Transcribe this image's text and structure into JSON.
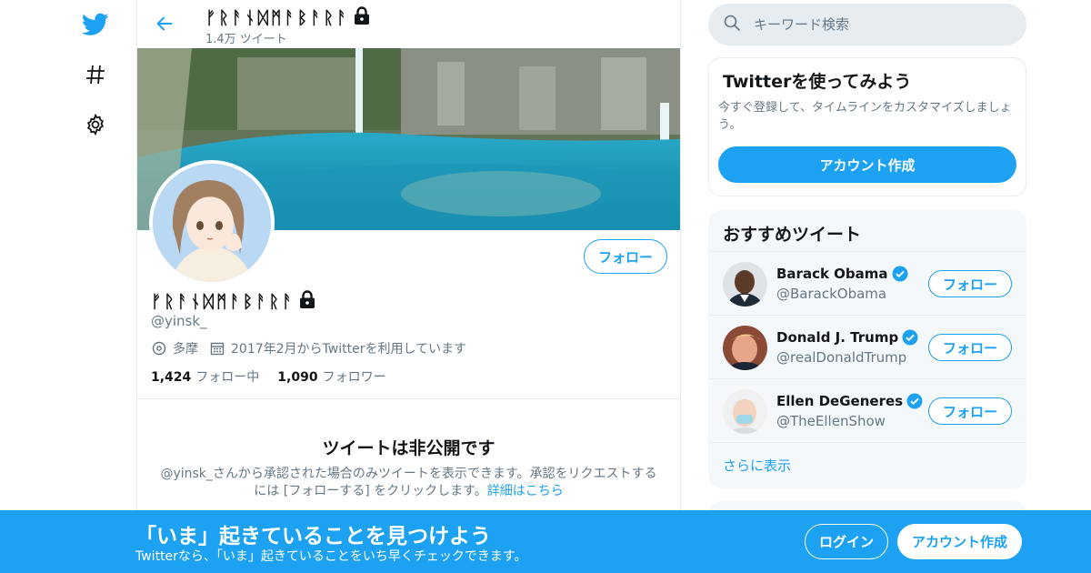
{
  "colors": {
    "accent": "#1da1f2",
    "text": "#14171a",
    "muted": "#657786",
    "border": "#e6ecf0"
  },
  "nav": {
    "items": [
      {
        "icon": "twitter-bird-icon"
      },
      {
        "icon": "hashtag-icon"
      },
      {
        "icon": "gear-icon"
      }
    ]
  },
  "profile": {
    "display_name": "ᚠᚱᚨᚾᛞᛗᚨᛒᚨᚱᚨ",
    "tweet_count": "1.4万 ツイート",
    "handle": "@yinsk_",
    "location": "多摩",
    "joined": "2017年2月からTwitterを利用しています",
    "following_count": "1,424",
    "following_label": "フォロー中",
    "followers_count": "1,090",
    "followers_label": "フォロワー",
    "follow_label": "フォロー"
  },
  "protected": {
    "title": "ツイートは非公開です",
    "body": "@yinsk_さんから承認された場合のみツイートを表示できます。承認をリクエストするには [フォローする] をクリックします。",
    "link": "詳細はこちら"
  },
  "search": {
    "placeholder": "キーワード検索"
  },
  "signup_card": {
    "title": "Twitterを使ってみよう",
    "body": "今すぐ登録して、タイムラインをカスタマイズしましょう。",
    "button": "アカウント作成"
  },
  "recommendations": {
    "title": "おすすめツイート",
    "items": [
      {
        "name": "Barack Obama",
        "handle": "@BarackObama",
        "follow": "フォロー"
      },
      {
        "name": "Donald J. Trump",
        "handle": "@realDonaldTrump",
        "follow": "フォロー"
      },
      {
        "name": "Ellen DeGeneres",
        "handle": "@TheEllenShow",
        "follow": "フォロー"
      }
    ],
    "more": "さらに表示"
  },
  "bottom_bar": {
    "title": "「いま」起きていることを見つけよう",
    "subtitle": "Twitterなら、「いま」起きていることをいち早くチェックできます。",
    "login": "ログイン",
    "signup": "アカウント作成"
  }
}
